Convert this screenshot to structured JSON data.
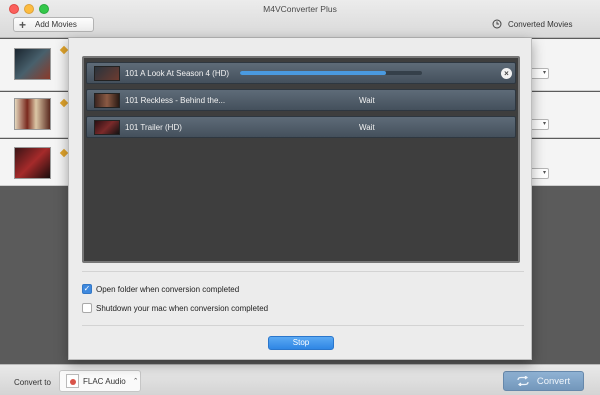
{
  "window": {
    "title": "M4VConverter Plus"
  },
  "toolbar": {
    "add_label": "Add Movies",
    "converted_label": "Converted Movies"
  },
  "bottom": {
    "convert_to_label": "Convert to",
    "format_value": "FLAC Audio",
    "convert_label": "Convert"
  },
  "queue": {
    "items": [
      {
        "name": "101 A Look At Season 4 (HD)",
        "status": "",
        "progress": 0.8
      },
      {
        "name": "101 Reckless - Behind the...",
        "status": "Wait"
      },
      {
        "name": "101 Trailer (HD)",
        "status": "Wait"
      }
    ]
  },
  "options": {
    "open_folder_label": "Open folder when conversion completed",
    "open_folder_checked": true,
    "shutdown_label": "Shutdown your mac when conversion completed",
    "shutdown_checked": false
  },
  "actions": {
    "stop_label": "Stop"
  },
  "colors": {
    "accent": "#3f89de",
    "progress": "#4a9ae0",
    "convert_button": "#7f9fc4"
  }
}
